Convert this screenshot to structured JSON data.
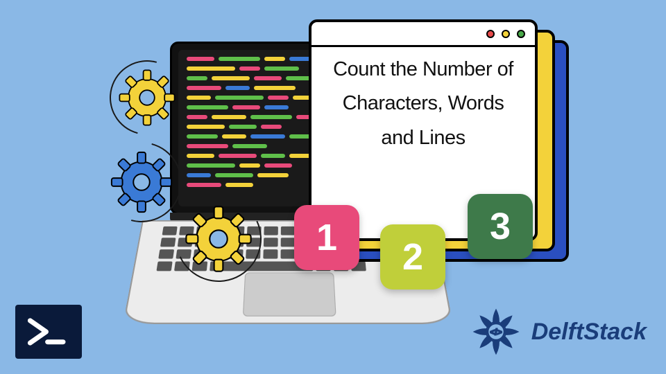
{
  "window": {
    "title": "Count the Number of Characters, Words and Lines"
  },
  "tiles": {
    "one": "1",
    "two": "2",
    "three": "3"
  },
  "brand": {
    "name": "DelftStack"
  },
  "colors": {
    "bg": "#8ab8e6",
    "pink": "#e84a7a",
    "olive": "#c0cf3a",
    "green": "#3e7a4a",
    "yellow": "#f3d23a",
    "blue": "#2a4fc0",
    "brand": "#1a3d7a"
  }
}
